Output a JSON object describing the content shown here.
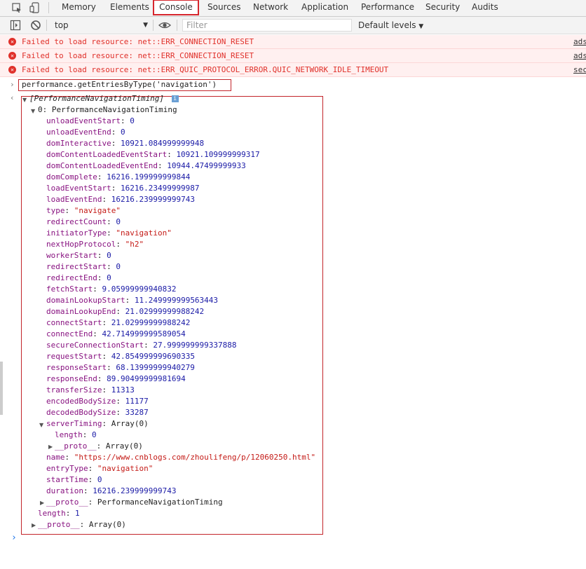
{
  "tabs": [
    "Memory",
    "Elements",
    "Console",
    "Sources",
    "Network",
    "Application",
    "Performance",
    "Security",
    "Audits"
  ],
  "toolbar": {
    "context": "top",
    "filter_placeholder": "Filter",
    "levels": "Default levels"
  },
  "errors": [
    {
      "message": "Failed to load resource: net::ERR_CONNECTION_RESET",
      "source": "ads"
    },
    {
      "message": "Failed to load resource: net::ERR_CONNECTION_RESET",
      "source": "ads"
    },
    {
      "message": "Failed to load resource: net::ERR_QUIC_PROTOCOL_ERROR.QUIC_NETWORK_IDLE_TIMEOUT",
      "source": "sec"
    }
  ],
  "command": "performance.getEntriesByType('navigation')",
  "result_header": "[PerformanceNavigationTiming]",
  "entry_label": "0: PerformanceNavigationTiming",
  "properties": [
    {
      "key": "unloadEventStart",
      "value": "0",
      "kind": "n"
    },
    {
      "key": "unloadEventEnd",
      "value": "0",
      "kind": "n"
    },
    {
      "key": "domInteractive",
      "value": "10921.084999999948",
      "kind": "n"
    },
    {
      "key": "domContentLoadedEventStart",
      "value": "10921.109999999317",
      "kind": "n"
    },
    {
      "key": "domContentLoadedEventEnd",
      "value": "10944.47499999933",
      "kind": "n"
    },
    {
      "key": "domComplete",
      "value": "16216.199999999844",
      "kind": "n"
    },
    {
      "key": "loadEventStart",
      "value": "16216.23499999987",
      "kind": "n"
    },
    {
      "key": "loadEventEnd",
      "value": "16216.239999999743",
      "kind": "n"
    },
    {
      "key": "type",
      "value": "\"navigate\"",
      "kind": "s"
    },
    {
      "key": "redirectCount",
      "value": "0",
      "kind": "n"
    },
    {
      "key": "initiatorType",
      "value": "\"navigation\"",
      "kind": "s"
    },
    {
      "key": "nextHopProtocol",
      "value": "\"h2\"",
      "kind": "s"
    },
    {
      "key": "workerStart",
      "value": "0",
      "kind": "n"
    },
    {
      "key": "redirectStart",
      "value": "0",
      "kind": "n"
    },
    {
      "key": "redirectEnd",
      "value": "0",
      "kind": "n"
    },
    {
      "key": "fetchStart",
      "value": "9.05999999940832",
      "kind": "n"
    },
    {
      "key": "domainLookupStart",
      "value": "11.249999999563443",
      "kind": "n"
    },
    {
      "key": "domainLookupEnd",
      "value": "21.02999999988242",
      "kind": "n"
    },
    {
      "key": "connectStart",
      "value": "21.02999999988242",
      "kind": "n"
    },
    {
      "key": "connectEnd",
      "value": "42.714999999589054",
      "kind": "n"
    },
    {
      "key": "secureConnectionStart",
      "value": "27.999999999337888",
      "kind": "n"
    },
    {
      "key": "requestStart",
      "value": "42.854999999690335",
      "kind": "n"
    },
    {
      "key": "responseStart",
      "value": "68.13999999940279",
      "kind": "n"
    },
    {
      "key": "responseEnd",
      "value": "89.90499999981694",
      "kind": "n"
    },
    {
      "key": "transferSize",
      "value": "11313",
      "kind": "n"
    },
    {
      "key": "encodedBodySize",
      "value": "11177",
      "kind": "n"
    },
    {
      "key": "decodedBodySize",
      "value": "33287",
      "kind": "n"
    }
  ],
  "server_timing": {
    "key": "serverTiming",
    "value": "Array(0)",
    "length_key": "length",
    "length_value": "0",
    "proto_key": "__proto__",
    "proto_value": "Array(0)"
  },
  "tail_properties": [
    {
      "key": "name",
      "value": "\"https://www.cnblogs.com/zhoulifeng/p/12060250.html\"",
      "kind": "s"
    },
    {
      "key": "entryType",
      "value": "\"navigation\"",
      "kind": "s"
    },
    {
      "key": "startTime",
      "value": "0",
      "kind": "n"
    },
    {
      "key": "duration",
      "value": "16216.239999999743",
      "kind": "n"
    }
  ],
  "entry_proto": {
    "key": "__proto__",
    "value": "PerformanceNavigationTiming"
  },
  "array_length": {
    "key": "length",
    "value": "1"
  },
  "array_proto": {
    "key": "__proto__",
    "value": "Array(0)"
  }
}
